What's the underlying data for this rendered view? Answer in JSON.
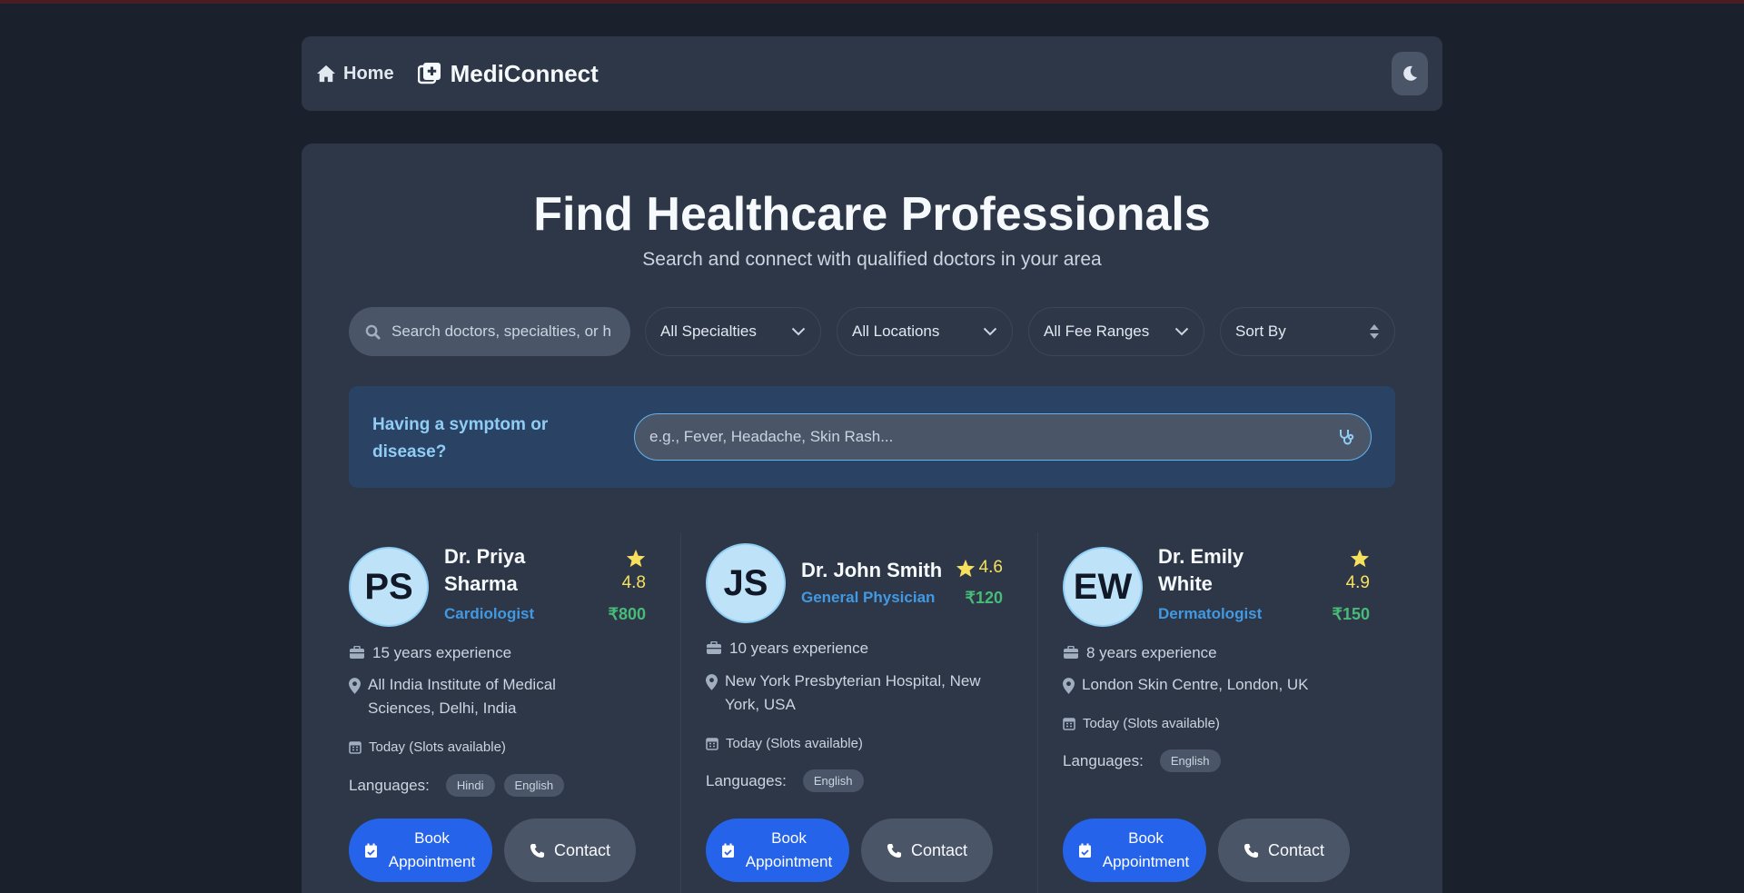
{
  "nav": {
    "home_label": "Home",
    "brand": "MediConnect"
  },
  "hero": {
    "title": "Find Healthcare Professionals",
    "subtitle": "Search and connect with qualified doctors in your area"
  },
  "filters": {
    "search_placeholder": "Search doctors, specialties, or h",
    "specialty": "All Specialties",
    "location": "All Locations",
    "fee": "All Fee Ranges",
    "sort": "Sort By"
  },
  "symptom": {
    "label": "Having a symptom or disease?",
    "placeholder": "e.g., Fever, Headache, Skin Rash..."
  },
  "doctors": [
    {
      "initials": "PS",
      "name": "Dr. Priya Sharma",
      "specialty": "Cardiologist",
      "rating": "4.8",
      "fee": "₹800",
      "experience": "15 years experience",
      "location": "All India Institute of Medical Sciences, Delhi, India",
      "availability": "Today (Slots available)",
      "languages_label": "Languages:",
      "languages": [
        "Hindi",
        "English"
      ],
      "book_label": "Book Appointment",
      "contact_label": "Contact"
    },
    {
      "initials": "JS",
      "name": "Dr. John Smith",
      "specialty": "General Physician",
      "rating": "4.6",
      "fee": "₹120",
      "experience": "10 years experience",
      "location": "New York Presbyterian Hospital, New York, USA",
      "availability": "Today (Slots available)",
      "languages_label": "Languages:",
      "languages": [
        "English"
      ],
      "book_label": "Book Appointment",
      "contact_label": "Contact"
    },
    {
      "initials": "EW",
      "name": "Dr. Emily White",
      "specialty": "Dermatologist",
      "rating": "4.9",
      "fee": "₹150",
      "experience": "8 years experience",
      "location": "London Skin Centre, London, UK",
      "availability": "Today (Slots available)",
      "languages_label": "Languages:",
      "languages": [
        "English"
      ],
      "book_label": "Book Appointment",
      "contact_label": "Contact"
    }
  ],
  "colors": {
    "background": "#1a202c",
    "panel": "#2d3748",
    "primary": "#2563eb",
    "accent_blue": "#4299e1",
    "rating_yellow": "#f6e05e",
    "fee_green": "#48bb78"
  },
  "icons": [
    "home-icon",
    "medical-plus-icon",
    "moon-icon",
    "search-icon",
    "chevron-down-icon",
    "sort-icon",
    "stethoscope-icon",
    "star-icon",
    "briefcase-icon",
    "map-pin-icon",
    "calendar-icon",
    "calendar-check-icon",
    "phone-icon"
  ]
}
